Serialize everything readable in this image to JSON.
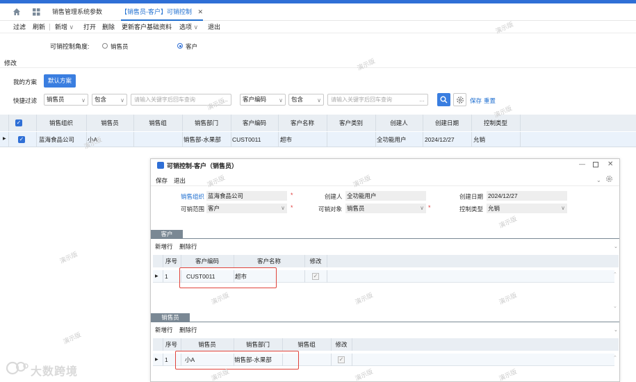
{
  "tabs": {
    "app_title": "销售管理系统参数",
    "active_tab": "【销售员-客户】可销控制"
  },
  "toolbar": {
    "filter": "过滤",
    "refresh": "刷新",
    "add": "新增",
    "open": "打开",
    "delete": "删除",
    "update_customer": "更新客户基础资料",
    "options": "选项",
    "exit": "退出"
  },
  "control_angle": {
    "label": "可销控制角度:",
    "opt_sales": "销售员",
    "opt_customer": "客户",
    "selected": "客户"
  },
  "section_edit": "修改",
  "scheme": {
    "my_scheme": "我的方案",
    "default_scheme": "默认方案"
  },
  "quick_filter": {
    "label": "快捷过滤",
    "field1": "销售员",
    "op1": "包含",
    "placeholder1": "请输入关键字后回车查询",
    "field2": "客户编码",
    "op2": "包含",
    "placeholder2": "请输入关键字后回车查询",
    "save": "保存",
    "reset": "重置"
  },
  "main_grid": {
    "headers": [
      "销售组织",
      "销售员",
      "销售组",
      "销售部门",
      "客户编码",
      "客户名称",
      "客户类别",
      "创建人",
      "创建日期",
      "控制类型"
    ],
    "row": [
      "蓝海食品公司",
      "小A",
      "",
      "销售部-水果部",
      "CUST0011",
      "超市",
      "",
      "全功能用户",
      "2024/12/27",
      "允销"
    ]
  },
  "dialog": {
    "title": "可销控制-客户（销售员）",
    "menu_save": "保存",
    "menu_exit": "退出",
    "sales_org_label": "销售组织",
    "sales_org_value": "蓝海食品公司",
    "creator_label": "创建人",
    "creator_value": "全功能用户",
    "create_date_label": "创建日期",
    "create_date_value": "2024/12/27",
    "scope_label": "可销范围",
    "scope_value": "客户",
    "target_label": "可销对象",
    "target_value": "销售员",
    "control_type_label": "控制类型",
    "control_type_value": "允销",
    "customer_section": "客户",
    "cust_add_row": "新增行",
    "cust_del_row": "删除行",
    "cust_headers": [
      "序号",
      "客户编码",
      "客户名称",
      "修改"
    ],
    "cust_row": [
      "1",
      "CUST0011",
      "超市"
    ],
    "sales_section": "销售员",
    "sales_add_row": "新增行",
    "sales_del_row": "删除行",
    "sales_headers": [
      "序号",
      "销售员",
      "销售部门",
      "销售组",
      "修改"
    ],
    "sales_row": [
      "1",
      "小A",
      "销售部-水果部",
      ""
    ]
  },
  "watermark_text": "演示版",
  "brand_text": "大数跨境",
  "colors": {
    "accent": "#2f6fd6",
    "active_tab": "#1f6fd0",
    "grid_header": "#e9eef3",
    "highlight_box": "#e0433b",
    "section_tab": "#7a8894"
  }
}
